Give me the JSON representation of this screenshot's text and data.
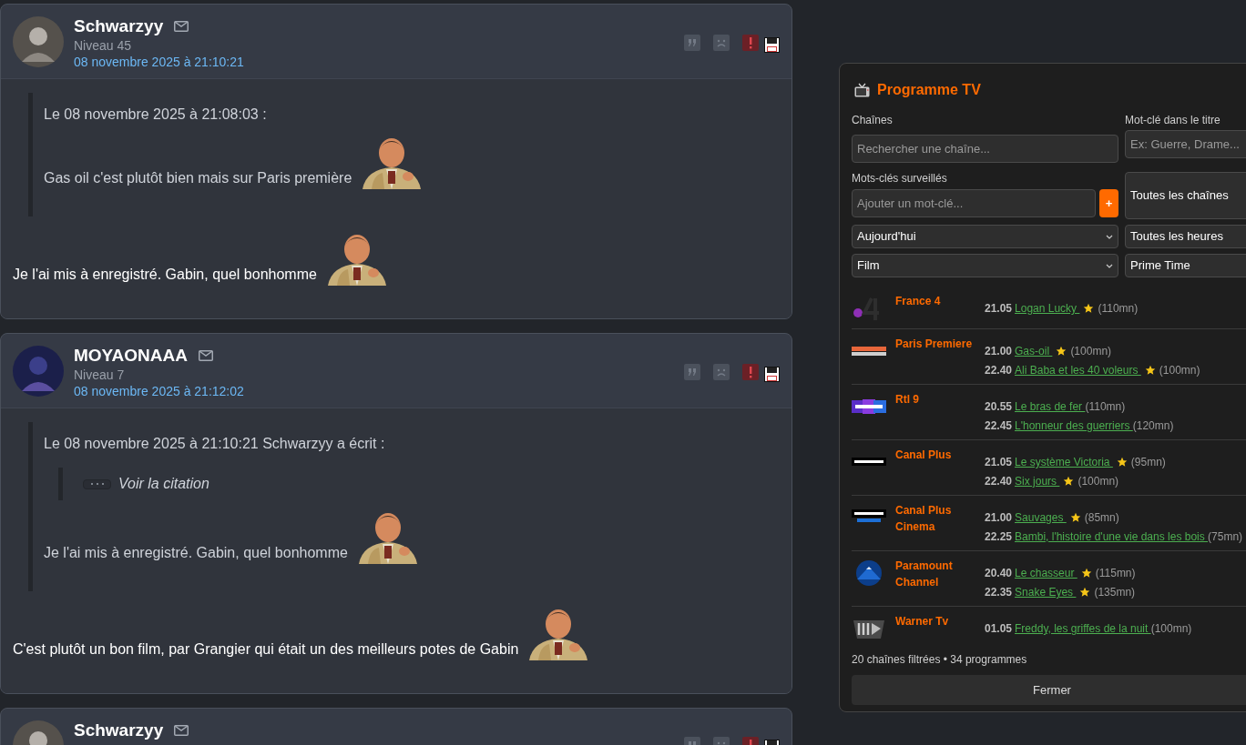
{
  "posts": [
    {
      "author": "Schwarzyy",
      "level": "Niveau 45",
      "date": "08 novembre 2025 à 21:10:21",
      "quote": {
        "header": "Le 08 novembre 2025 à 21:08:03 :",
        "text": "Gas oil c'est plutôt bien mais sur Paris première"
      },
      "text": "Je l'ai mis à enregistré. Gabin, quel bonhomme"
    },
    {
      "author": "MOYAONAAA",
      "level": "Niveau 7",
      "date": "08 novembre 2025 à 21:12:02",
      "quote": {
        "header": "Le 08 novembre 2025 à 21:10:21 Schwarzyy a écrit :",
        "nested": {
          "label": "Voir la citation"
        },
        "text": "Je l'ai mis à enregistré. Gabin, quel bonhomme"
      },
      "text": "C'est plutôt un bon film, par Grangier qui était un des meilleurs potes de Gabin"
    },
    {
      "author": "Schwarzyy"
    }
  ],
  "tv": {
    "title": "Programme TV",
    "channels_label": "Chaînes",
    "channels_placeholder": "Rechercher une chaîne...",
    "keyword_label": "Mot-clé dans le titre",
    "keyword_placeholder": "Ex: Guerre, Drame...",
    "watch_label": "Mots-clés surveillés",
    "watch_placeholder": "Ajouter un mot-clé...",
    "add_button": "+",
    "channel_filter": "Toutes les chaînes",
    "day": "Aujourd'hui",
    "hours": "Toutes les heures",
    "genre": "Film",
    "slot": "Prime Time",
    "listing": [
      {
        "channel": "France 4",
        "kind": "four",
        "programmes": [
          {
            "time": "21.05",
            "title": "Logan Lucky ",
            "starred": true,
            "duration": "(110mn)"
          }
        ]
      },
      {
        "channel": "Paris Premiere",
        "kind": "stripes",
        "programmes": [
          {
            "time": "21.00",
            "title": "Gas-oil ",
            "starred": true,
            "duration": "(100mn)"
          },
          {
            "time": "22.40",
            "title": "Ali Baba et les 40 voleurs ",
            "starred": true,
            "duration": "(100mn)"
          }
        ]
      },
      {
        "channel": "Rtl 9",
        "kind": "blocks",
        "programmes": [
          {
            "time": "20.55",
            "title": "Le bras de fer ",
            "starred": false,
            "duration": "(110mn)"
          },
          {
            "time": "22.45",
            "title": "L'honneur des guerriers ",
            "starred": false,
            "duration": "(120mn)"
          }
        ]
      },
      {
        "channel": "Canal Plus",
        "kind": "bar",
        "programmes": [
          {
            "time": "21.05",
            "title": "Le système Victoria ",
            "starred": true,
            "duration": "(95mn)"
          },
          {
            "time": "22.40",
            "title": "Six jours ",
            "starred": true,
            "duration": "(100mn)"
          }
        ]
      },
      {
        "channel": "Canal Plus Cinema",
        "kind": "bar2",
        "programmes": [
          {
            "time": "21.00",
            "title": "Sauvages ",
            "starred": true,
            "duration": "(85mn)"
          },
          {
            "time": "22.25",
            "title": "Bambi, l'histoire d'une vie dans les bois ",
            "starred": false,
            "duration": "(75mn)"
          }
        ]
      },
      {
        "channel": "Paramount Channel",
        "kind": "mountain",
        "programmes": [
          {
            "time": "20.40",
            "title": "Le chasseur ",
            "starred": true,
            "duration": "(115mn)"
          },
          {
            "time": "22.35",
            "title": "Snake Eyes ",
            "starred": true,
            "duration": "(135mn)"
          }
        ]
      },
      {
        "channel": "Warner Tv",
        "kind": "shield",
        "programmes": [
          {
            "time": "01.05",
            "title": "Freddy, les griffes de la nuit ",
            "starred": false,
            "duration": "(100mn)"
          }
        ]
      }
    ],
    "summary": "20 chaînes filtrées • 34 programmes",
    "close": "Fermer"
  }
}
